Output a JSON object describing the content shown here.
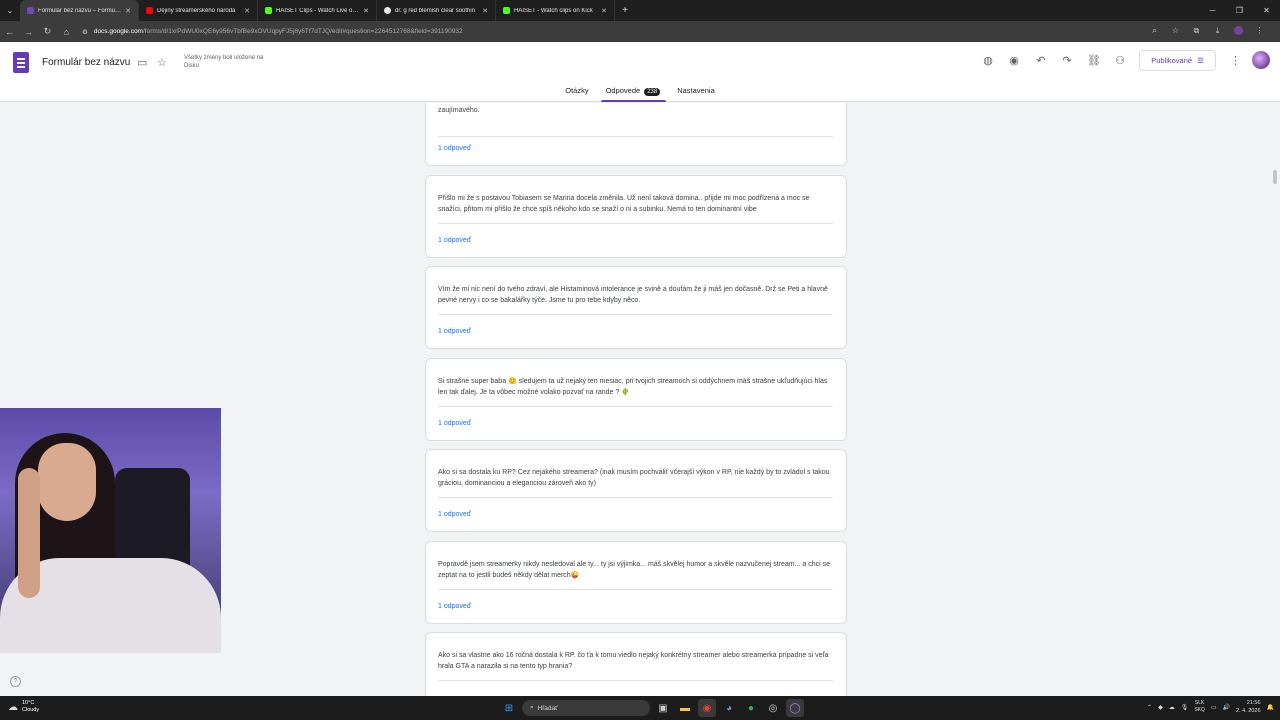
{
  "browser": {
    "tabs": [
      {
        "title": "Formulár bez názvu – Formulár",
        "active": true,
        "color": "#7248b9"
      },
      {
        "title": "Dějiny streamerského národa",
        "active": false,
        "color": "#ff0000"
      },
      {
        "title": "HAISET Clips - Watch Live on K",
        "active": false,
        "color": "#53fc18"
      },
      {
        "title": "dr. g red blemish clear soothin",
        "active": false,
        "color": "#e8eaed"
      },
      {
        "title": "HAISET - Watch clips on Kick",
        "active": false,
        "color": "#53fc18"
      }
    ],
    "url_host": "docs.google.com",
    "url_path": "/forms/d/1xrPdWU0xQE6y956vTbfBe9xOVUqpyFJ5j8y6Tf7dTJQ/edit#question=2264512768&field=391190932"
  },
  "header": {
    "title": "Formulár bez názvu",
    "saved_status": "Všetky zmeny boli uložené na Disku",
    "publish_label": "Publikované",
    "tabs": {
      "questions": "Otázky",
      "responses": "Odpovede",
      "responses_count": "238",
      "settings": "Nastavenia"
    }
  },
  "responses": [
    {
      "text": "zaujímavého.",
      "link": "1 odpoveď"
    },
    {
      "text": "Přišlo mi že s postavou Tobiasem se Marina docela změnila. Už není taková domina.. přijde mi moc podřízená a moc se snažíci, přitom mi přišlo že chce spíš někoho kdo se snaží o ni a subinku. Nemá to ten dominantní vibe",
      "link": "1 odpoveď"
    },
    {
      "text": "Vím že mi nic není do tvého zdraví, ale Histaminová intolerance je svině a doufám že ji máš jen dočasně. Drž se Peti a hlavně pevné nervy i co se bakalářky týče. Jsme tu pro tebe kdyby něco.",
      "link": "1 odpoveď"
    },
    {
      "text": "Si strašne super baba 😊 sledujem ta už nejaký ten mesiac, pri tvojich streamoch si oddýchnem máš strašne ukľudňujúci hlas len tak ďalej. Je ta vôbec možné volako pozvať na rande ? 🌵",
      "link": "1 odpoveď"
    },
    {
      "text": "Ako si sa dostala ku RP? Cez nejakého streamera? (inak musím pochváliť včerajší výkon v RP, nie každý by to zvládol s takou gráciou, dominanciou a eleganciou zároveň ako ty)",
      "link": "1 odpoveď"
    },
    {
      "text": "Popravdě jsem streamerky nikdy nesledoval ale ty... ty jsi výjimka... máš skvělej humor a skvěle nazvučenej stream... a chci se zeptat na to jestli budeš někdy dělat merch😜",
      "link": "1 odpoveď"
    },
    {
      "text": "Ako si sa vlastne ako 16 ročná dostala k RP. čo ťa k tomu viedlo nejaký konkrétny streamer alebo streamerka prípadne si veľa hrala GTA a narazila si na tento typ hrania?",
      "link": ""
    }
  ],
  "taskbar": {
    "weather_temp": "10°C",
    "weather_desc": "Cloudy",
    "search_placeholder": "Hľadať",
    "lang_top": "SLK",
    "lang_bottom": "SKQ",
    "time": "21:56",
    "date": "2. 4. 2026"
  },
  "colors": {
    "accent": "#673ab7",
    "link": "#1a73e8"
  }
}
